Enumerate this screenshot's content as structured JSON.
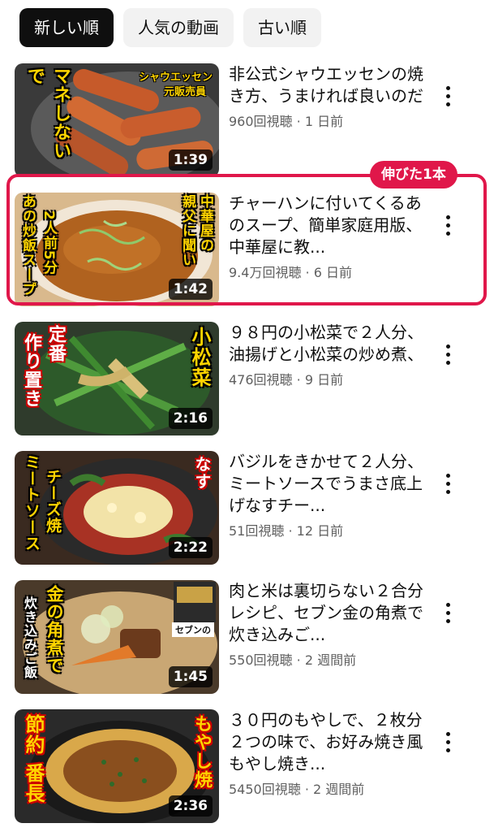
{
  "filters": {
    "items": [
      {
        "label": "新しい順",
        "selected": true
      },
      {
        "label": "人気の動画",
        "selected": false
      },
      {
        "label": "古い順",
        "selected": false
      }
    ]
  },
  "highlight": {
    "badge_label": "伸びた1本",
    "color": "#e0174a"
  },
  "videos": [
    {
      "title": "非公式シャウエッセンの焼き方、うまければ良いのだ",
      "views": "960回視聴",
      "age": "1 日前",
      "duration": "1:39",
      "thumb_text": [
        "シャウエッセン",
        "元販売員",
        "マネしないで"
      ]
    },
    {
      "title": "チャーハンに付いてくるあのスープ、簡単家庭用版、中華屋に教...",
      "views": "9.4万回視聴",
      "age": "6 日前",
      "duration": "1:42",
      "thumb_text": [
        "あの炒飯スープ",
        "2人前5分",
        "中華屋の",
        "親父に聞い"
      ]
    },
    {
      "title": "９８円の小松菜で２人分、油揚げと小松菜の炒め煮、",
      "views": "476回視聴",
      "age": "9 日前",
      "duration": "2:16",
      "thumb_text": [
        "定番",
        "作り置き",
        "小松菜"
      ]
    },
    {
      "title": "バジルをきかせて２人分、ミートソースでうまさ底上げなすチー...",
      "views": "51回視聴",
      "age": "12 日前",
      "duration": "2:22",
      "thumb_text": [
        "ミートソース",
        "チーズ焼",
        "なす"
      ]
    },
    {
      "title": "肉と米は裏切らない２合分レシピ、セブン金の角煮で炊き込みご...",
      "views": "550回視聴",
      "age": "2 週間前",
      "duration": "1:45",
      "thumb_text": [
        "金の角煮で",
        "炊き込みご飯",
        "セブンの"
      ]
    },
    {
      "title": "３０円のもやしで、２枚分２つの味で、お好み焼き風もやし焼き...",
      "views": "5450回視聴",
      "age": "2 週間前",
      "duration": "2:36",
      "thumb_text": [
        "節約",
        "番長",
        "もやし焼"
      ]
    }
  ],
  "meta_separator": " · "
}
